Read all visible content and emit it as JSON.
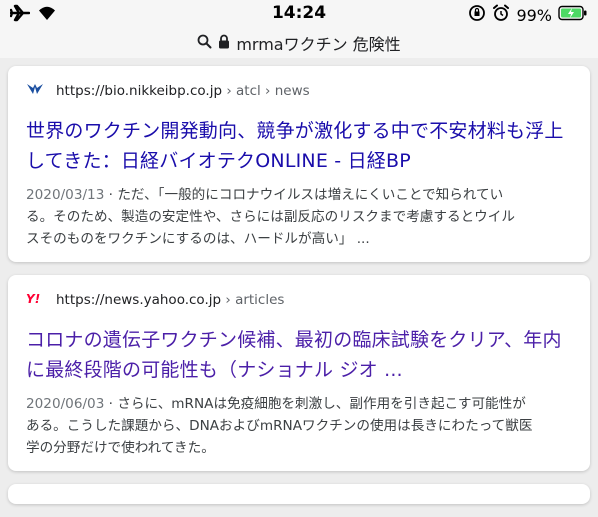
{
  "status_bar": {
    "time": "14:24",
    "battery_percent": "99%",
    "icons": [
      "airplane-icon",
      "wifi-icon",
      "rotation-lock-icon",
      "alarm-icon",
      "battery-charging-icon"
    ]
  },
  "address_bar": {
    "query": "mrmaワクチン 危険性",
    "icons": [
      "search-icon",
      "lock-icon"
    ]
  },
  "results": [
    {
      "site_url": "https://bio.nikkeibp.co.jp",
      "breadcrumb": "› atcl › news",
      "title_line1": "世界のワクチン開発動向、競争が激化する中で不安材料も浮上",
      "title_line2": "してきた：日経バイオテクONLINE - 日経BP",
      "date": "2020/03/13",
      "snippet_line1_rest": " · ただ、「一般的にコロナウイルスは増えにくいことで知られてい",
      "snippet_line2": "る。そのため、製造の安定性や、さらには副反応のリスクまで考慮するとウイル",
      "snippet_line3": "スそのものをワクチンにするのは、ハードルが高い」 ...",
      "favicon_color": "#1b4fa0"
    },
    {
      "site_url": "https://news.yahoo.co.jp",
      "breadcrumb": "› articles",
      "title_line1": "コロナの遺伝子ワクチン候補、最初の臨床試験をクリア、年内",
      "title_line2": "に最終段階の可能性も（ナショナル ジオ ...",
      "date": "2020/06/03",
      "snippet_line1_rest": " · さらに、mRNAは免疫細胞を刺激し、副作用を引き起こす可能性が",
      "snippet_line2": "ある。こうした課題から、DNAおよびmRNAワクチンの使用は長きにわたって獣医",
      "snippet_line3": "学の分野だけで使われてきた。",
      "favicon_color": "#ff0033"
    }
  ]
}
